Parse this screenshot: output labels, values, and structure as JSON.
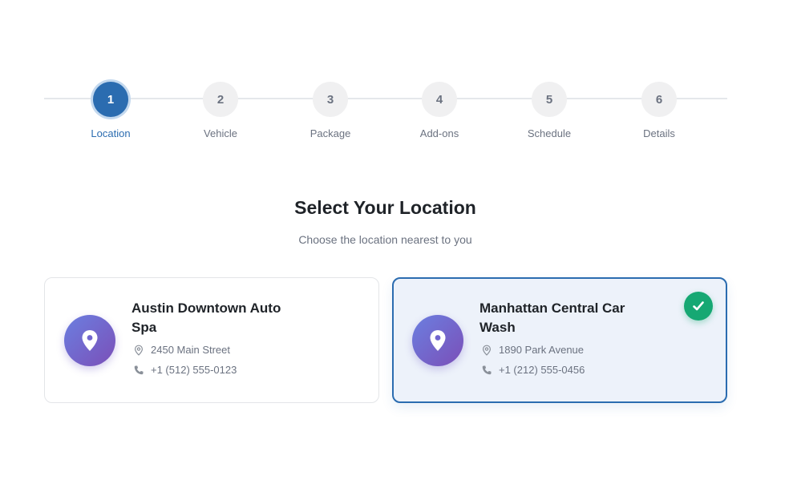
{
  "stepper": {
    "active_step": 1,
    "steps": [
      {
        "number": "1",
        "label": "Location"
      },
      {
        "number": "2",
        "label": "Vehicle"
      },
      {
        "number": "3",
        "label": "Package"
      },
      {
        "number": "4",
        "label": "Add-ons"
      },
      {
        "number": "5",
        "label": "Schedule"
      },
      {
        "number": "6",
        "label": "Details"
      }
    ]
  },
  "header": {
    "title": "Select Your Location",
    "subtitle": "Choose the location nearest to you"
  },
  "locations": [
    {
      "name": "Austin Downtown Auto Spa",
      "address": "2450 Main Street",
      "phone": "+1 (512) 555-0123",
      "selected": false
    },
    {
      "name": "Manhattan Central Car Wash",
      "address": "1890 Park Avenue",
      "phone": "+1 (212) 555-0456",
      "selected": true
    }
  ],
  "icons": {
    "card_icon": "map-pin-icon",
    "address_icon": "location-pin-icon",
    "phone_icon": "phone-icon",
    "selected_icon": "checkmark-icon"
  },
  "colors": {
    "accent": "#2b6cb0",
    "selected_card_bg": "#edf2fa",
    "check_badge": "#16a873",
    "icon_gradient_start": "#6b7fe0",
    "icon_gradient_end": "#7b4fb8",
    "inactive_step": "#f0f0f1",
    "muted_text": "#6b7280"
  }
}
